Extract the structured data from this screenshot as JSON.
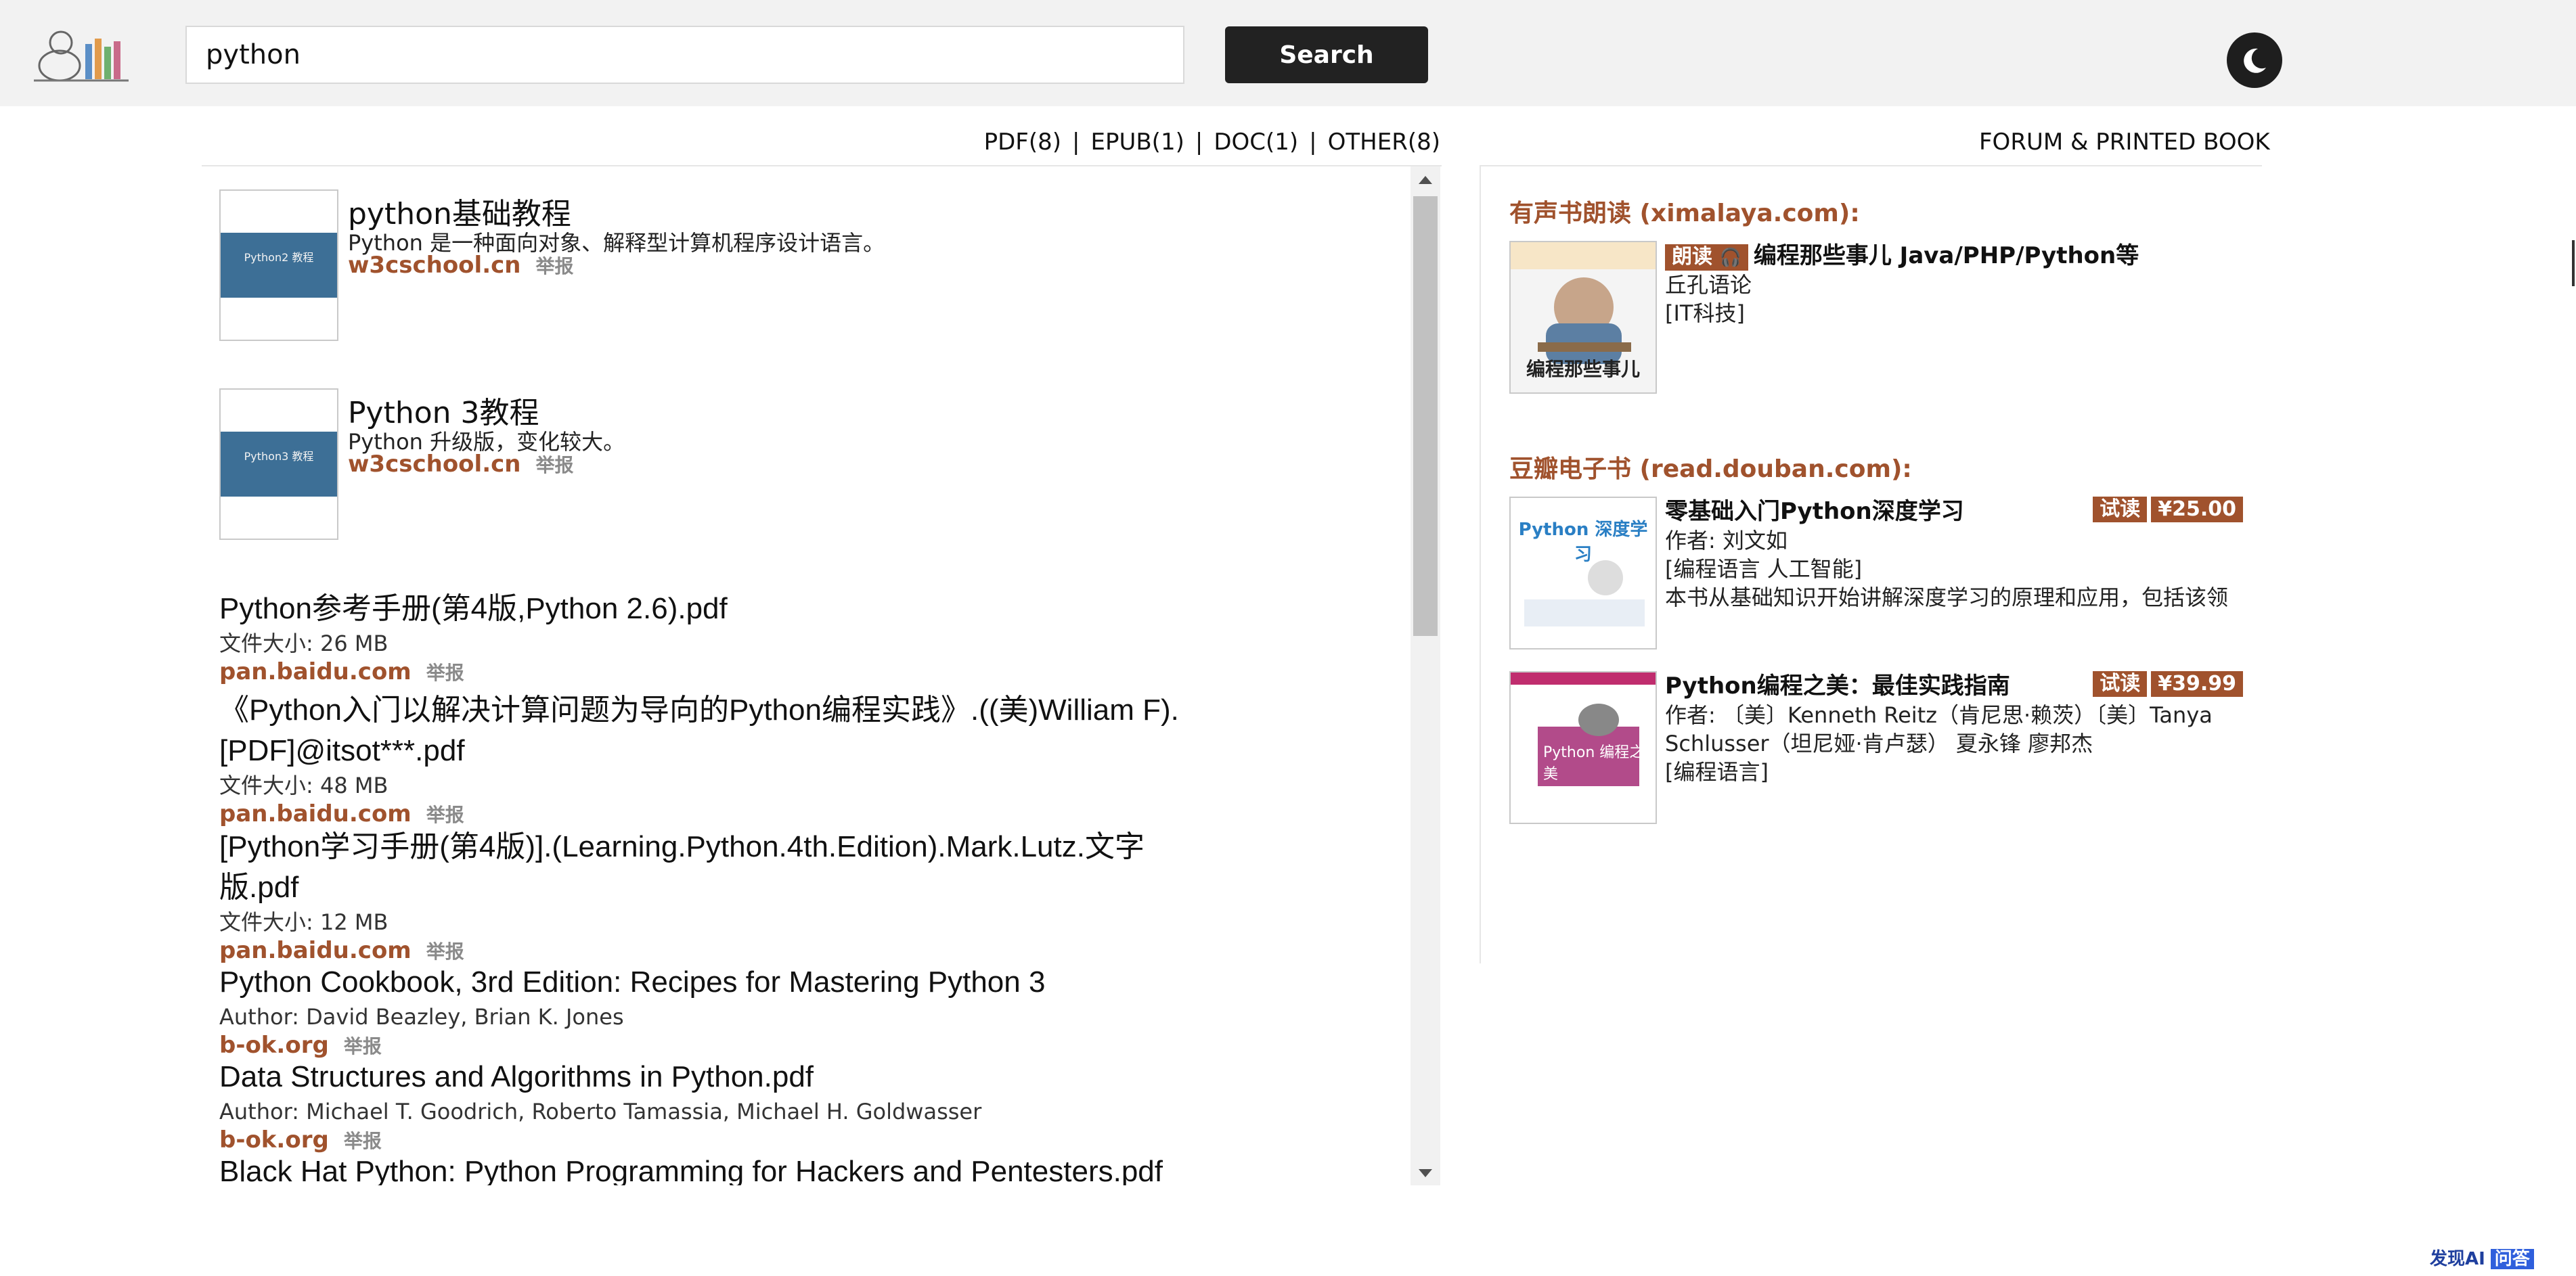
{
  "header": {
    "logo_icon": "library-books-logo",
    "search_value": "python",
    "search_button": "Search",
    "theme_icon": "moon-icon"
  },
  "filters": [
    {
      "label": "PDF(8)"
    },
    {
      "label": "EPUB(1)"
    },
    {
      "label": "DOC(1)"
    },
    {
      "label": "OTHER(8)"
    }
  ],
  "forum_link": "FORUM & PRINTED BOOK",
  "results": {
    "cards": [
      {
        "title": "python基础教程",
        "desc": "Python 是一种面向对象、解释型计算机程序设计语言。",
        "source": "w3cschool.cn",
        "report": "举报",
        "cover_text": "Python2 教程"
      },
      {
        "title": "Python 3教程",
        "desc": "Python 升级版，变化较大。",
        "source": "w3cschool.cn",
        "report": "举报",
        "cover_text": "Python3 教程"
      }
    ],
    "files": [
      {
        "title": "Python参考手册(第4版,Python 2.6).pdf",
        "meta": "文件大小: 26 MB",
        "source": "pan.baidu.com",
        "report": "举报"
      },
      {
        "title": "《Python入门以解决计算问题为导向的Python编程实践》.((美)William F).[PDF]@itsot***.pdf",
        "meta": "文件大小: 48 MB",
        "source": "pan.baidu.com",
        "report": "举报"
      },
      {
        "title": "[Python学习手册(第4版)].(Learning.Python.4th.Edition).Mark.Lutz.文字版.pdf",
        "meta": "文件大小: 12 MB",
        "source": "pan.baidu.com",
        "report": "举报"
      },
      {
        "title": "Python Cookbook, 3rd Edition: Recipes for Mastering Python 3",
        "meta": "Author: David Beazley, Brian K. Jones",
        "source": "b-ok.org",
        "report": "举报"
      },
      {
        "title": "Data Structures and Algorithms in Python.pdf",
        "meta": "Author: Michael T. Goodrich, Roberto Tamassia, Michael H. Goldwasser",
        "source": "b-ok.org",
        "report": "举报"
      },
      {
        "title": "Black Hat Python: Python Programming for Hackers and Pentesters.pdf",
        "meta": "",
        "source": "",
        "report": ""
      }
    ]
  },
  "sidebar": {
    "ximalaya": {
      "heading": "有声书朗读 (ximalaya.com):",
      "badge": "朗读",
      "badge_icon": "headphones-icon",
      "title": "编程那些事儿 Java/PHP/Python等",
      "author": "丘孔语论",
      "category": "[IT科技]",
      "cover_caption": "编程那些事儿"
    },
    "douban": {
      "heading": "豆瓣电子书 (read.douban.com):",
      "books": [
        {
          "title": "零基础入门Python深度学习",
          "trial": "试读",
          "price": "¥25.00",
          "author": "作者: 刘文如",
          "category": "[编程语言 人工智能]",
          "summary": "本书从基础知识开始讲解深度学习的原理和应用，包括该领",
          "cover_label": "Python 深度学习"
        },
        {
          "title": "Python编程之美：最佳实践指南",
          "trial": "试读",
          "price": "¥39.99",
          "author": "作者: 〔美〕Kenneth Reitz（肯尼思·赖茨）〔美〕Tanya Schlusser（坦尼娅·肯卢瑟） 夏永锋 廖邦杰",
          "category": "[编程语言]",
          "cover_label": "Python 编程之美"
        }
      ]
    }
  },
  "footer": {
    "brand": "发现AI",
    "qa": "问答"
  }
}
